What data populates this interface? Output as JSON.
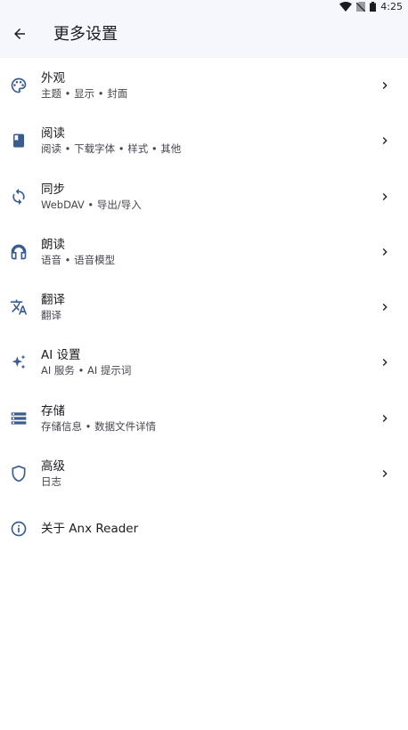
{
  "status_bar": {
    "time": "4:25"
  },
  "app_bar": {
    "title": "更多设置"
  },
  "colors": {
    "icon": "#3a5c8f",
    "text": "#1b1c20",
    "subtext": "#45464f",
    "bar_bg": "#f6f7fd"
  },
  "settings": [
    {
      "label": "外观",
      "sub": "主题 • 显示 • 封面",
      "icon": "palette-icon"
    },
    {
      "label": "阅读",
      "sub": "阅读 • 下载字体 • 样式 • 其他",
      "icon": "book-icon"
    },
    {
      "label": "同步",
      "sub": "WebDAV • 导出/导入",
      "icon": "sync-icon"
    },
    {
      "label": "朗读",
      "sub": "语音 • 语音模型",
      "icon": "headphones-icon"
    },
    {
      "label": "翻译",
      "sub": "翻译",
      "icon": "translate-icon"
    },
    {
      "label": "AI 设置",
      "sub": "AI 服务 • AI 提示词",
      "icon": "sparkle-icon"
    },
    {
      "label": "存储",
      "sub": "存储信息 • 数据文件详情",
      "icon": "storage-icon"
    },
    {
      "label": "高级",
      "sub": "日志",
      "icon": "shield-icon"
    },
    {
      "label": "关于 Anx Reader",
      "icon": "info-icon"
    }
  ]
}
